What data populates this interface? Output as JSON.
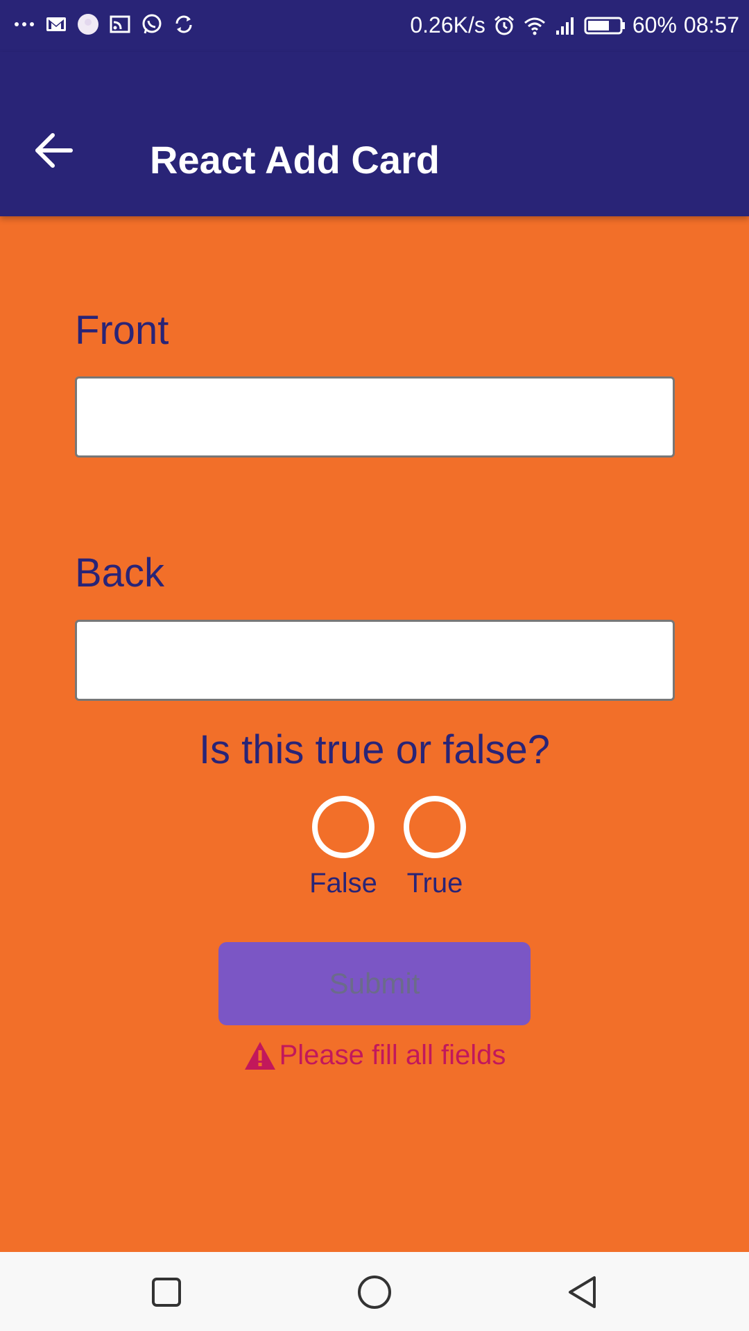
{
  "status_bar": {
    "network_speed": "0.26K/s",
    "battery": "60%",
    "time": "08:57",
    "icons_left": [
      "more-dots-icon",
      "gmail-icon",
      "avatar-icon",
      "cast-icon",
      "whatsapp-icon",
      "sync-icon"
    ],
    "icons_right": [
      "alarm-icon",
      "wifi-icon",
      "signal-icon",
      "battery-icon"
    ]
  },
  "app_bar": {
    "title": "React Add Card",
    "back_icon": "arrow-left-icon",
    "background": "#292477"
  },
  "form": {
    "front_label": "Front",
    "front_value": "",
    "back_label": "Back",
    "back_value": "",
    "question": "Is this true or false?",
    "options": [
      {
        "label": "False",
        "selected": false
      },
      {
        "label": "True",
        "selected": false
      }
    ],
    "submit_label": "Submit",
    "error_message": "Please fill all fields",
    "error_icon": "warning-icon"
  },
  "colors": {
    "background": "#f26f29",
    "accent": "#292477",
    "button": "#7b56c5",
    "error": "#c2185b"
  },
  "nav_bar": {
    "icons": [
      "recents-square-icon",
      "home-circle-icon",
      "back-triangle-icon"
    ]
  }
}
